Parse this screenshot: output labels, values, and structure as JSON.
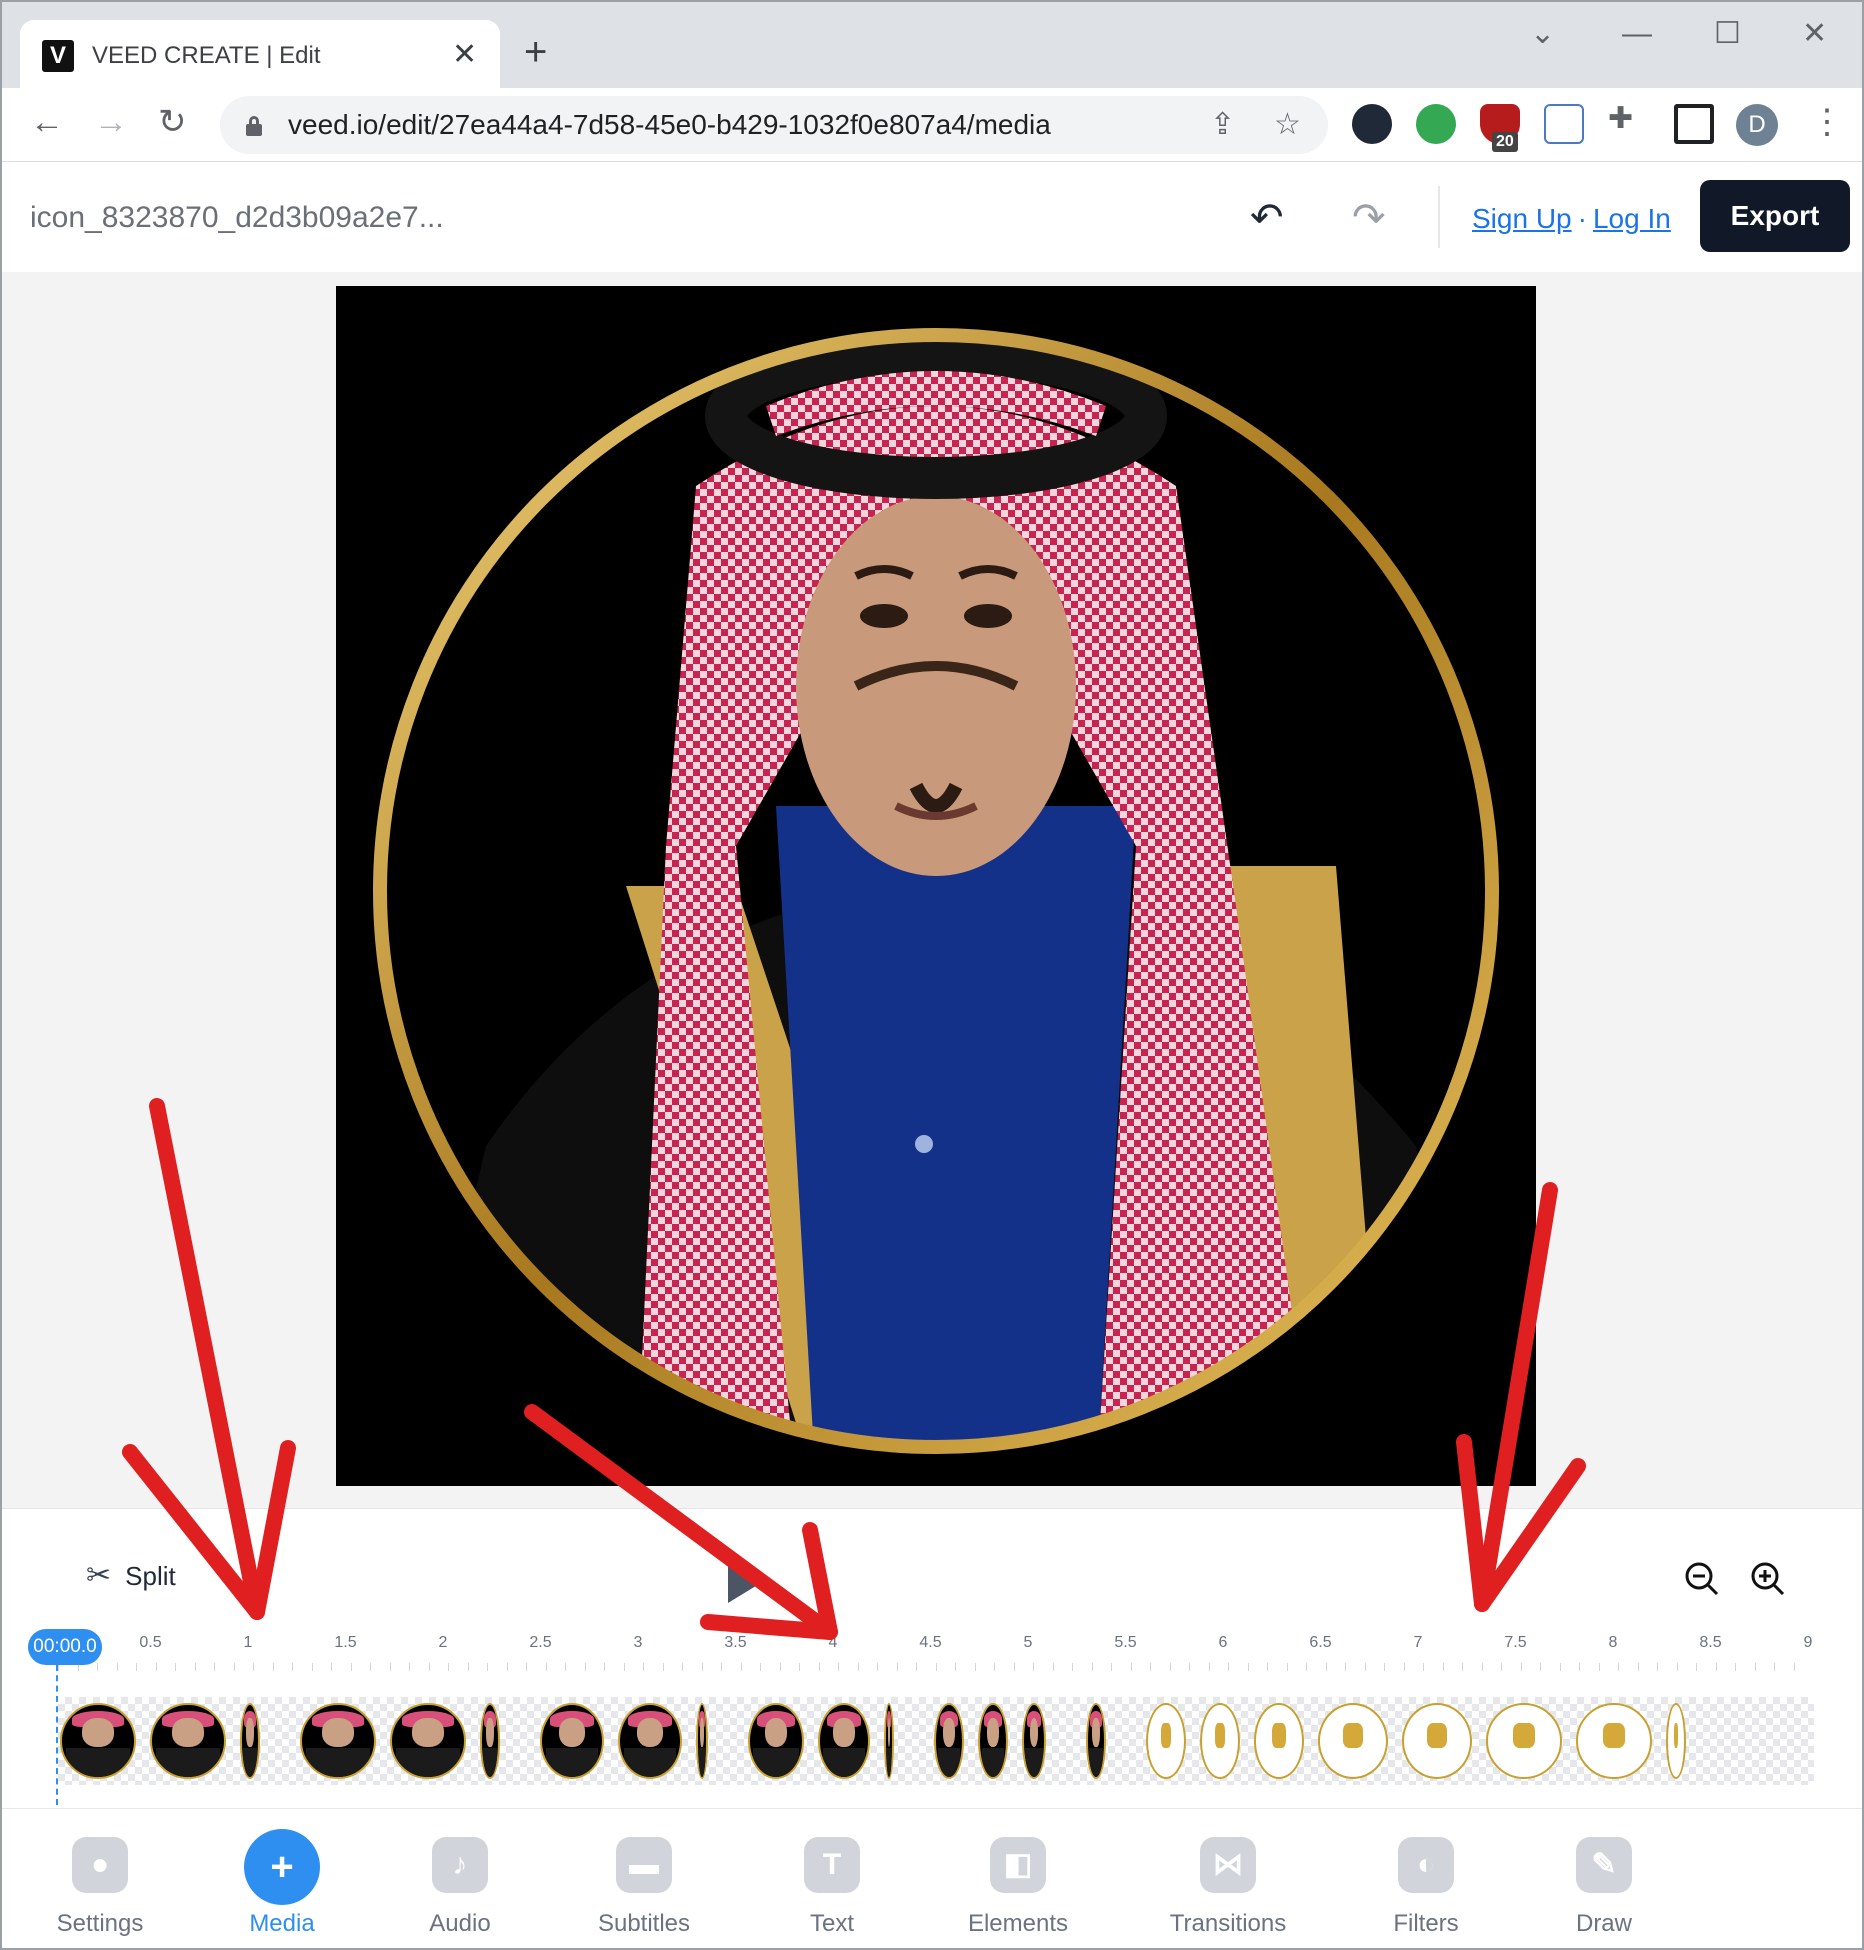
{
  "browser": {
    "tab_title": "VEED CREATE | Edit",
    "favicon_letter": "V",
    "url": "veed.io/edit/27ea44a4-7d58-45e0-b429-1032f0e807a4/media",
    "extension_badge": "20",
    "profile_initial": "D"
  },
  "header": {
    "project_title": "icon_8323870_d2d3b09a2e7...",
    "sign_up": "Sign Up",
    "separator": "·",
    "log_in": "Log In",
    "export_label": "Export"
  },
  "timeline": {
    "split_label": "Split",
    "current_time": "00:00.0",
    "ticks": [
      "0.5",
      "1",
      "1.5",
      "2",
      "2.5",
      "3",
      "3.5",
      "4",
      "4.5",
      "5",
      "5.5",
      "6",
      "6.5",
      "7",
      "7.5",
      "8",
      "8.5",
      "9"
    ]
  },
  "nav": [
    {
      "label": "Settings",
      "icon": "gear-icon",
      "active": false
    },
    {
      "label": "Media",
      "icon": "plus-icon",
      "active": true
    },
    {
      "label": "Audio",
      "icon": "music-note-icon",
      "active": false
    },
    {
      "label": "Subtitles",
      "icon": "subtitles-icon",
      "active": false
    },
    {
      "label": "Text",
      "icon": "text-icon",
      "active": false
    },
    {
      "label": "Elements",
      "icon": "elements-icon",
      "active": false
    },
    {
      "label": "Transitions",
      "icon": "transitions-icon",
      "active": false
    },
    {
      "label": "Filters",
      "icon": "filters-icon",
      "active": false
    },
    {
      "label": "Draw",
      "icon": "pencil-icon",
      "active": false
    }
  ],
  "colors": {
    "accent": "#2f8ff0",
    "export_bg": "#111827",
    "annotation_red": "#e02020"
  }
}
